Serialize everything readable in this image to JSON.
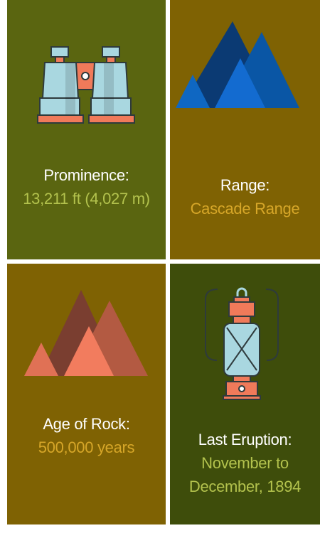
{
  "colors": {
    "olive": "#5a6510",
    "gold_bg": "#7f6203",
    "dark_green": "#3e4d0b",
    "green_value": "#b3c24d",
    "gold_value": "#d6a628"
  },
  "cards": [
    {
      "icon": "binoculars-icon",
      "title": "Prominence:",
      "value": "13,211 ft (4,027 m)"
    },
    {
      "icon": "mountains-icon",
      "title": "Range:",
      "value": "Cascade Range"
    },
    {
      "icon": "mountains-icon",
      "title": "Age of Rock:",
      "value": "500,000 years"
    },
    {
      "icon": "lantern-icon",
      "title": "Last Eruption:",
      "value": "November to December, 1894"
    }
  ]
}
